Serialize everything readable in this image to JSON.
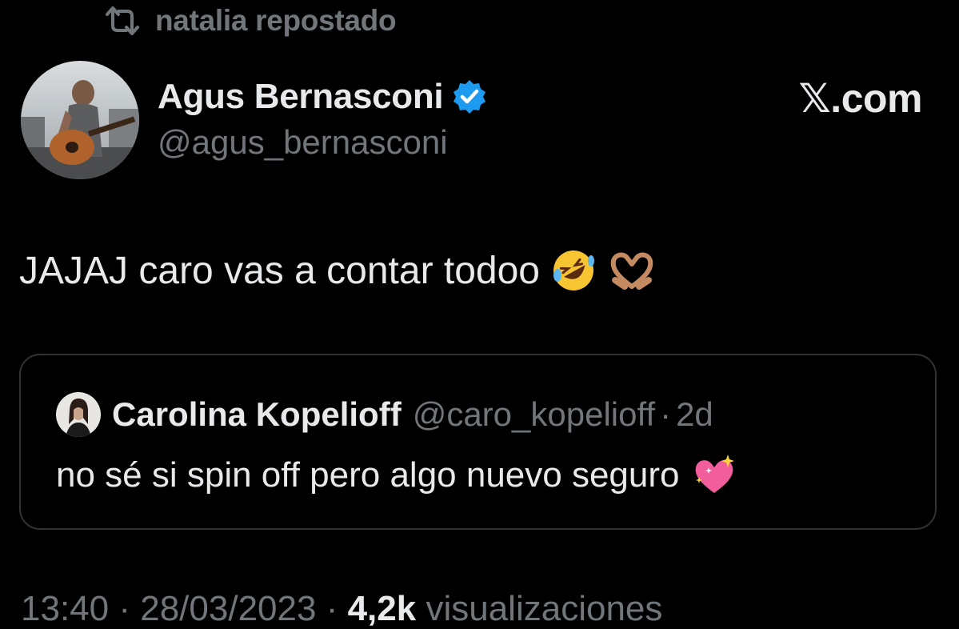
{
  "repost": {
    "icon": "repost-icon",
    "text": "natalia repostado"
  },
  "author": {
    "avatar": "avatar",
    "name": "Agus Bernasconi",
    "verified_icon": "verified-badge-icon",
    "handle": "@agus_bernasconi"
  },
  "brand": "𝕏.com",
  "tweet": {
    "text": "JAJAJ caro vas a contar todoo",
    "emojis": [
      "rolling-on-floor-laughing-emoji",
      "heart-hands-emoji"
    ]
  },
  "quote": {
    "name": "Carolina Kopelioff",
    "handle": "@caro_kopelioff",
    "separator": "·",
    "time": "2d",
    "text": "no sé si spin off pero algo nuevo seguro",
    "emoji": "sparkling-heart-emoji"
  },
  "meta": {
    "time": "13:40",
    "separator": "·",
    "date": "28/03/2023",
    "views": "4,2k",
    "views_label": "visualizaciones"
  },
  "colors": {
    "background": "#000000",
    "text": "#e7e9ea",
    "muted": "#71767b",
    "verified": "#1d9bf0",
    "border": "#2f3336"
  }
}
